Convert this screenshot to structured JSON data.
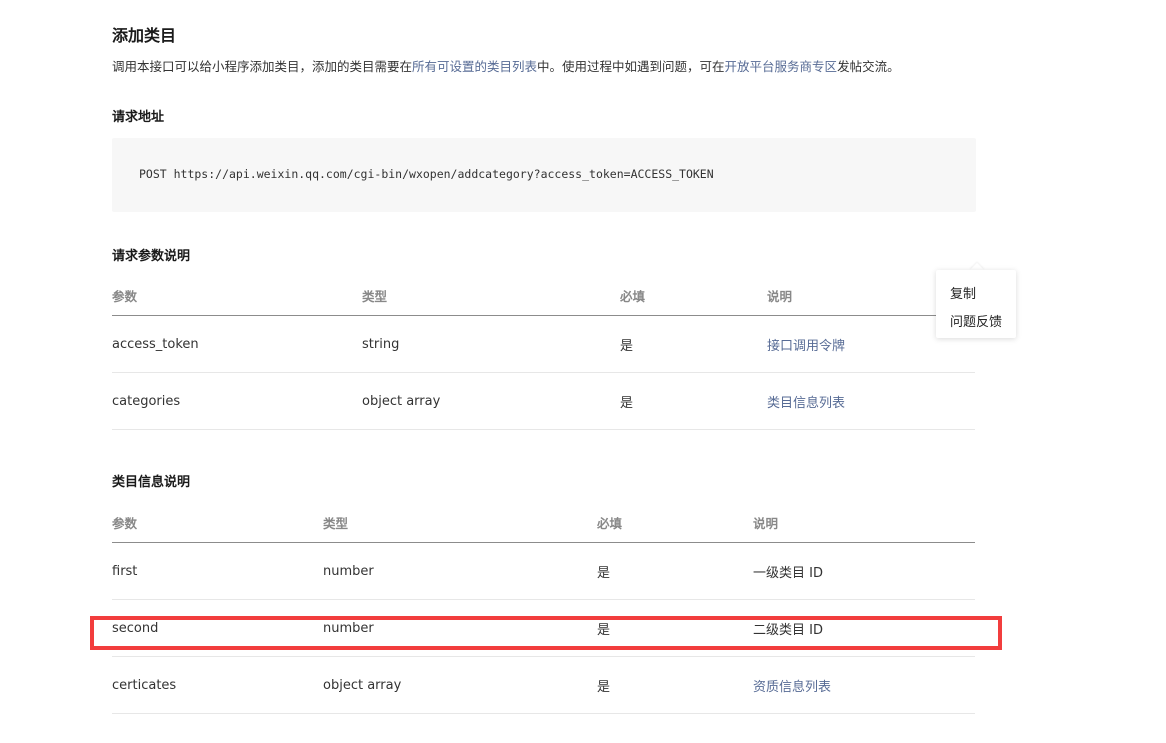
{
  "page": {
    "title": "添加类目",
    "description": {
      "part1": "调用本接口可以给小程序添加类目，添加的类目需要在",
      "link1": "所有可设置的类目列表",
      "part2": "中。使用过程中如遇到问题，可在",
      "link2": "开放平台服务商专区",
      "part3": "发帖交流。"
    }
  },
  "request_address": {
    "heading": "请求地址",
    "code": "POST https://api.weixin.qq.com/cgi-bin/wxopen/addcategory?access_token=ACCESS_TOKEN"
  },
  "request_params": {
    "heading": "请求参数说明",
    "columns": [
      "参数",
      "类型",
      "必填",
      "说明"
    ],
    "rows": [
      [
        "access_token",
        "string",
        "是",
        "接口调用令牌"
      ],
      [
        "categories",
        "object array",
        "是",
        "类目信息列表"
      ]
    ]
  },
  "category_info": {
    "heading": "类目信息说明",
    "columns": [
      "参数",
      "类型",
      "必填",
      "说明"
    ],
    "rows": [
      [
        "first",
        "number",
        "是",
        "一级类目 ID"
      ],
      [
        "second",
        "number",
        "是",
        "二级类目 ID"
      ],
      [
        "certicates",
        "object array",
        "是",
        "资质信息列表"
      ]
    ]
  },
  "context_menu": {
    "items": [
      "复制",
      "问题反馈"
    ]
  },
  "colors": {
    "link": "#576b95",
    "highlight": "#f23d3d",
    "code_bg": "#f7f7f7"
  }
}
